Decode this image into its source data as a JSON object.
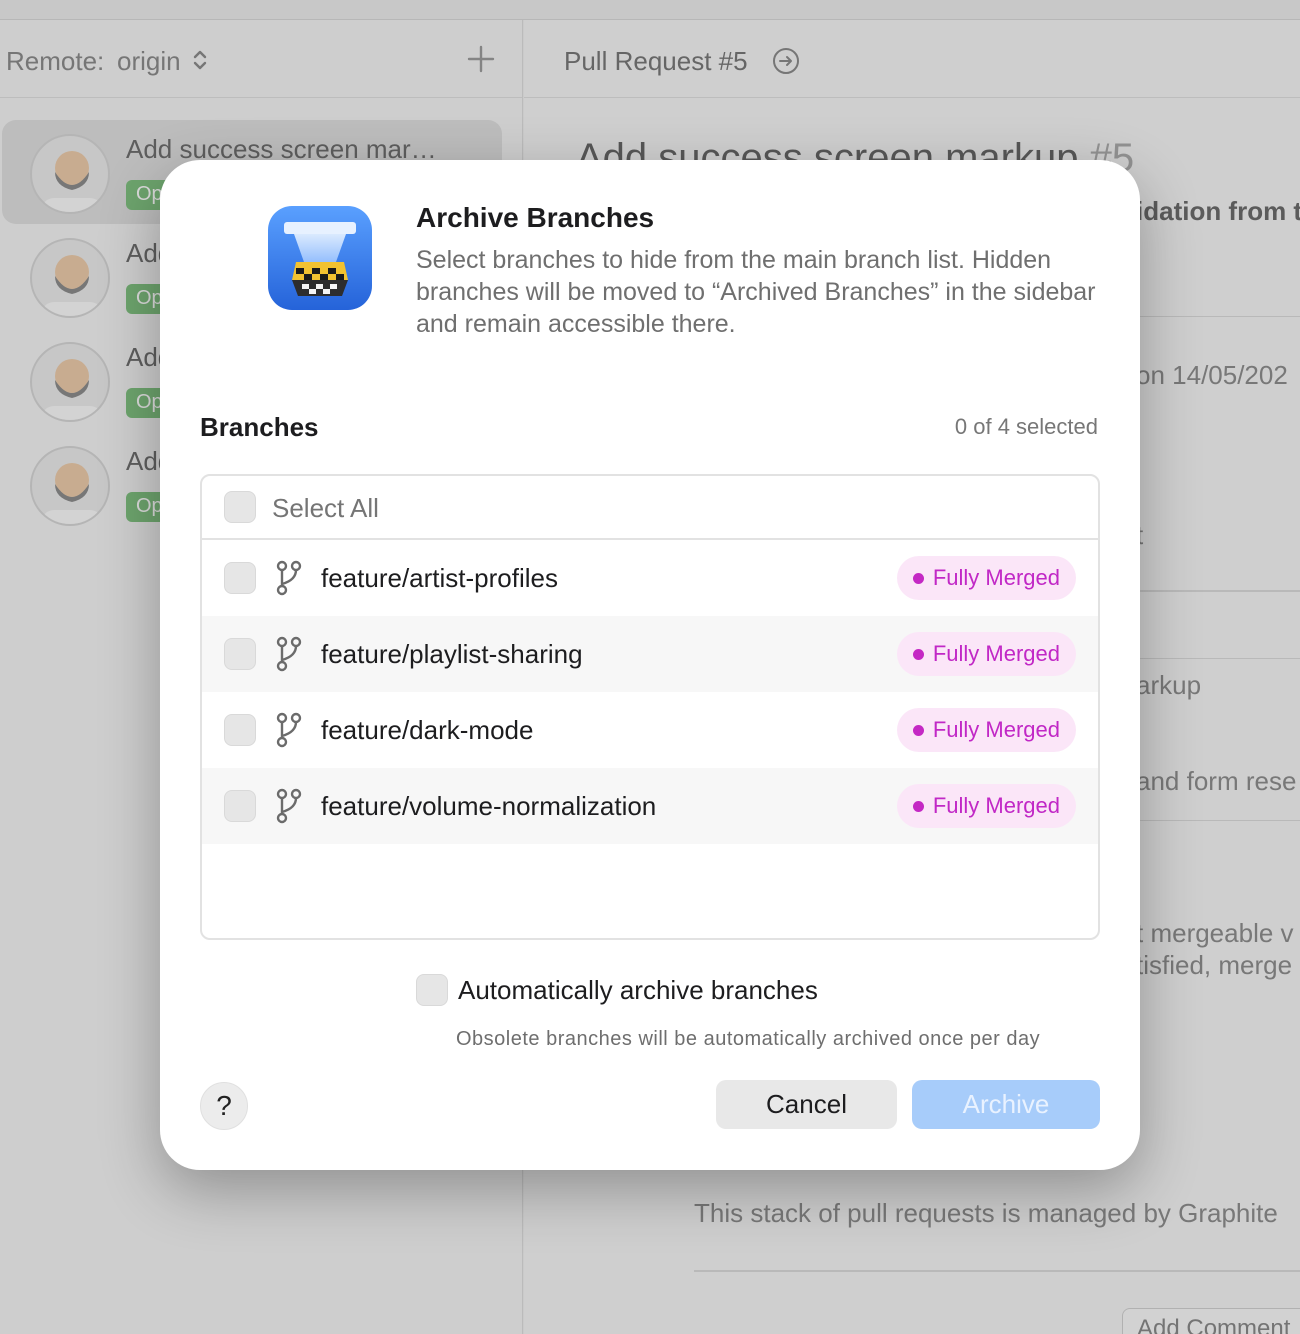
{
  "background": {
    "sidebar": {
      "remote_label": "Remote:",
      "remote_value": "origin",
      "pull_requests": [
        {
          "title": "Add success screen mar…",
          "badge": "Op"
        },
        {
          "title": "Add",
          "badge": "Op"
        },
        {
          "title": "Add",
          "badge": "Op"
        },
        {
          "title": "Add",
          "badge": "Op"
        }
      ]
    },
    "main": {
      "header_title": "Pull Request #5",
      "pr_title": "Add success screen markup",
      "pr_number": "#5",
      "text_fragments": {
        "validation": "idation from t",
        "date": "on 14/05/202",
        "t": "t",
        "markup": "arkup",
        "form_reset": "and form rese",
        "mergeable": "t mergeable v",
        "satisfied": "tisfied, merge",
        "graphite": "This stack of pull requests is managed by Graphite",
        "add_comment": "Add Comment"
      }
    }
  },
  "dialog": {
    "title": "Archive Branches",
    "description": "Select branches to hide from the main branch list. Hidden branches will be moved to “Archived Branches” in the sidebar and remain accessible there.",
    "section_label": "Branches",
    "selected_count": "0 of 4 selected",
    "select_all_label": "Select All",
    "branches": [
      {
        "name": "feature/artist-profiles",
        "status": "Fully Merged",
        "checked": false
      },
      {
        "name": "feature/playlist-sharing",
        "status": "Fully Merged",
        "checked": false
      },
      {
        "name": "feature/dark-mode",
        "status": "Fully Merged",
        "checked": false
      },
      {
        "name": "feature/volume-normalization",
        "status": "Fully Merged",
        "checked": false
      }
    ],
    "auto_archive_label": "Automatically archive branches",
    "auto_archive_hint": "Obsolete branches will be automatically archived once per day",
    "help_label": "?",
    "cancel_label": "Cancel",
    "archive_label": "Archive",
    "archive_enabled": false,
    "colors": {
      "accent_disabled": "#a7ccfa",
      "merged_badge_bg": "#fbe6f8",
      "merged_badge_text": "#c128c6"
    },
    "icons": [
      "app-icon",
      "branch-icon"
    ]
  }
}
